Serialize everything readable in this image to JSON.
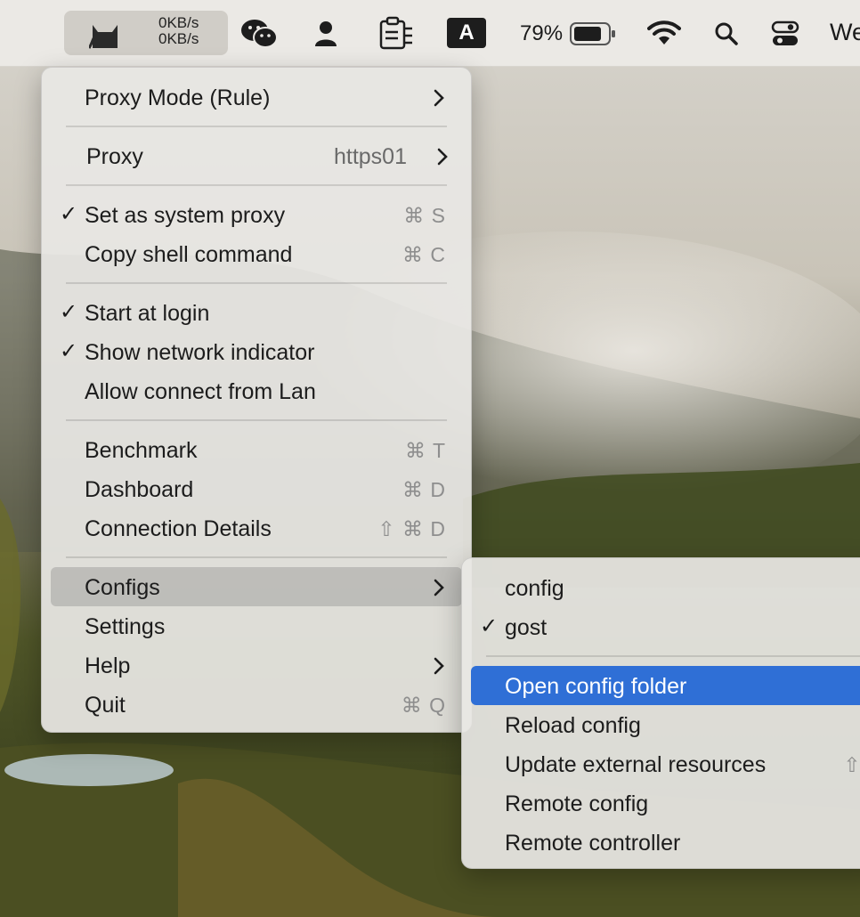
{
  "menubar": {
    "upload_speed": "0KB/s",
    "download_speed": "0KB/s",
    "input_source": "A",
    "battery_percent": "79%",
    "clock_partial": "We",
    "icons": [
      "cat-app-icon",
      "wechat-icon",
      "user-icon",
      "clipboard-icon",
      "input-source-icon",
      "battery-icon",
      "wifi-icon",
      "search-icon",
      "control-center-icon"
    ]
  },
  "main_menu": {
    "proxy_mode": "Proxy Mode (Rule)",
    "proxy_label": "Proxy",
    "proxy_value": "https01",
    "set_system_proxy": "Set as system proxy",
    "set_system_proxy_shortcut": "⌘ S",
    "copy_shell": "Copy shell command",
    "copy_shell_shortcut": "⌘ C",
    "start_login": "Start at login",
    "show_network": "Show network indicator",
    "allow_lan": "Allow connect from Lan",
    "benchmark": "Benchmark",
    "benchmark_shortcut": "⌘ T",
    "dashboard": "Dashboard",
    "dashboard_shortcut": "⌘ D",
    "connection_details": "Connection Details",
    "connection_details_shortcut": "⇧ ⌘ D",
    "configs": "Configs",
    "settings": "Settings",
    "help": "Help",
    "quit": "Quit",
    "quit_shortcut": "⌘ Q",
    "checkmark": "✓"
  },
  "configs_submenu": {
    "config": "config",
    "gost": "gost",
    "open_folder": "Open config folder",
    "open_folder_shortcut": "⌘",
    "reload": "Reload config",
    "reload_shortcut": "⌘",
    "update_external": "Update external resources",
    "update_external_shortcut": "⇧ ⌘",
    "remote_config": "Remote config",
    "remote_controller": "Remote controller",
    "checkmark": "✓"
  },
  "colors": {
    "highlight_blue": "#2f6fd6",
    "menu_bg": "#e8e7e4",
    "menubar_bg": "#ebe9e5"
  }
}
